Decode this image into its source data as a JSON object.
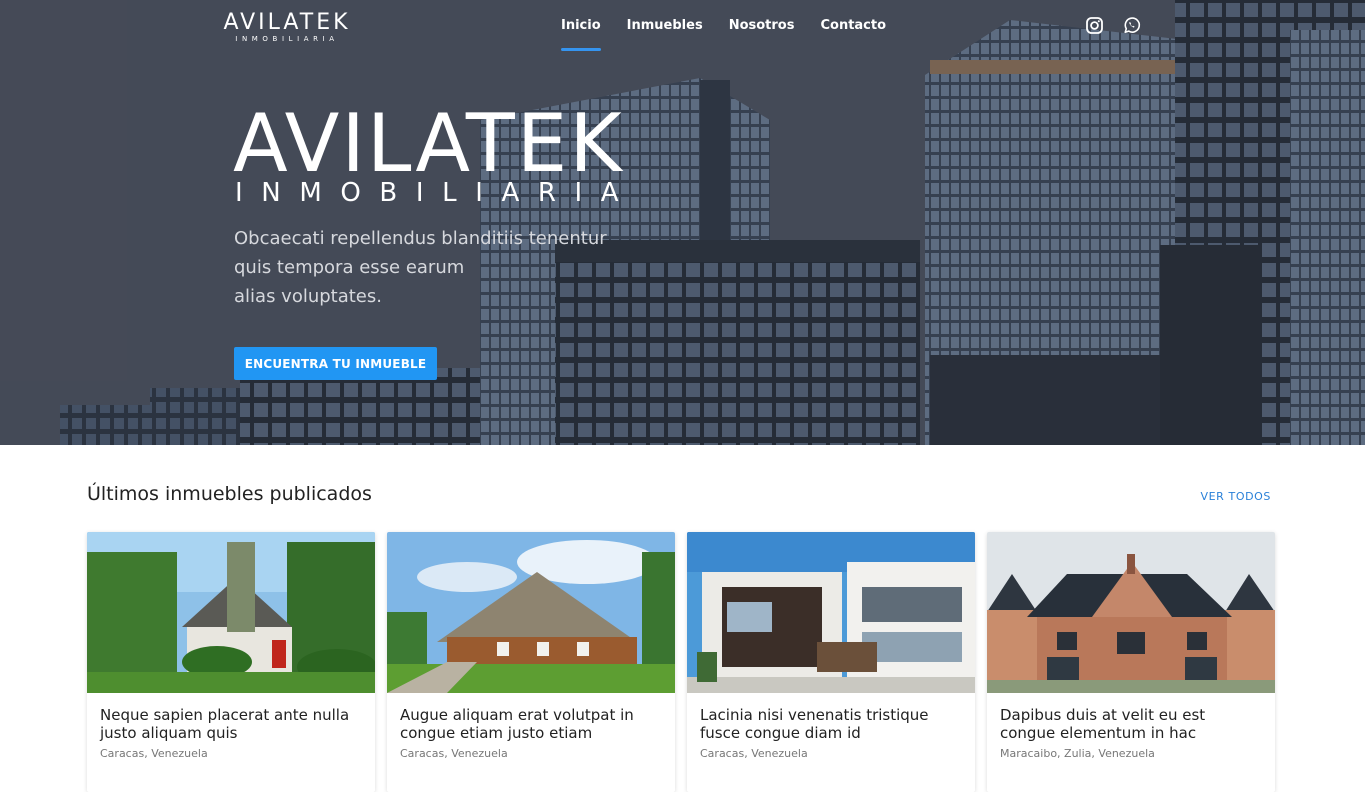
{
  "brand": {
    "name": "AVILATEK",
    "tagline": "INMOBILIARIA"
  },
  "nav": {
    "items": [
      {
        "label": "Inicio",
        "active": true
      },
      {
        "label": "Inmuebles",
        "active": false
      },
      {
        "label": "Nosotros",
        "active": false
      },
      {
        "label": "Contacto",
        "active": false
      }
    ],
    "social_icons": [
      "instagram-icon",
      "whatsapp-icon"
    ]
  },
  "hero": {
    "title": "AVILATEK",
    "subtitle": "INMOBILIARIA",
    "description_lines": [
      "Obcaecati repellendus blanditiis tenentur",
      "quis tempora esse earum",
      "alias voluptates."
    ],
    "cta_label": "ENCUENTRA TU INMUEBLE"
  },
  "listings": {
    "title": "Últimos inmuebles publicados",
    "see_all_label": "VER TODOS",
    "cards": [
      {
        "title": "Neque sapien placerat ante nulla justo aliquam quis",
        "location": "Caracas, Venezuela"
      },
      {
        "title": "Augue aliquam erat volutpat in congue etiam justo etiam",
        "location": "Caracas, Venezuela"
      },
      {
        "title": "Lacinia nisi venenatis tristique fusce congue diam id",
        "location": "Caracas, Venezuela"
      },
      {
        "title": "Dapibus duis at velit eu est congue elementum in hac",
        "location": "Maracaibo, Zulia, Venezuela"
      }
    ]
  },
  "colors": {
    "accent": "#2196f3",
    "link": "#2980d8",
    "hero_overlay": "#3f4553"
  }
}
